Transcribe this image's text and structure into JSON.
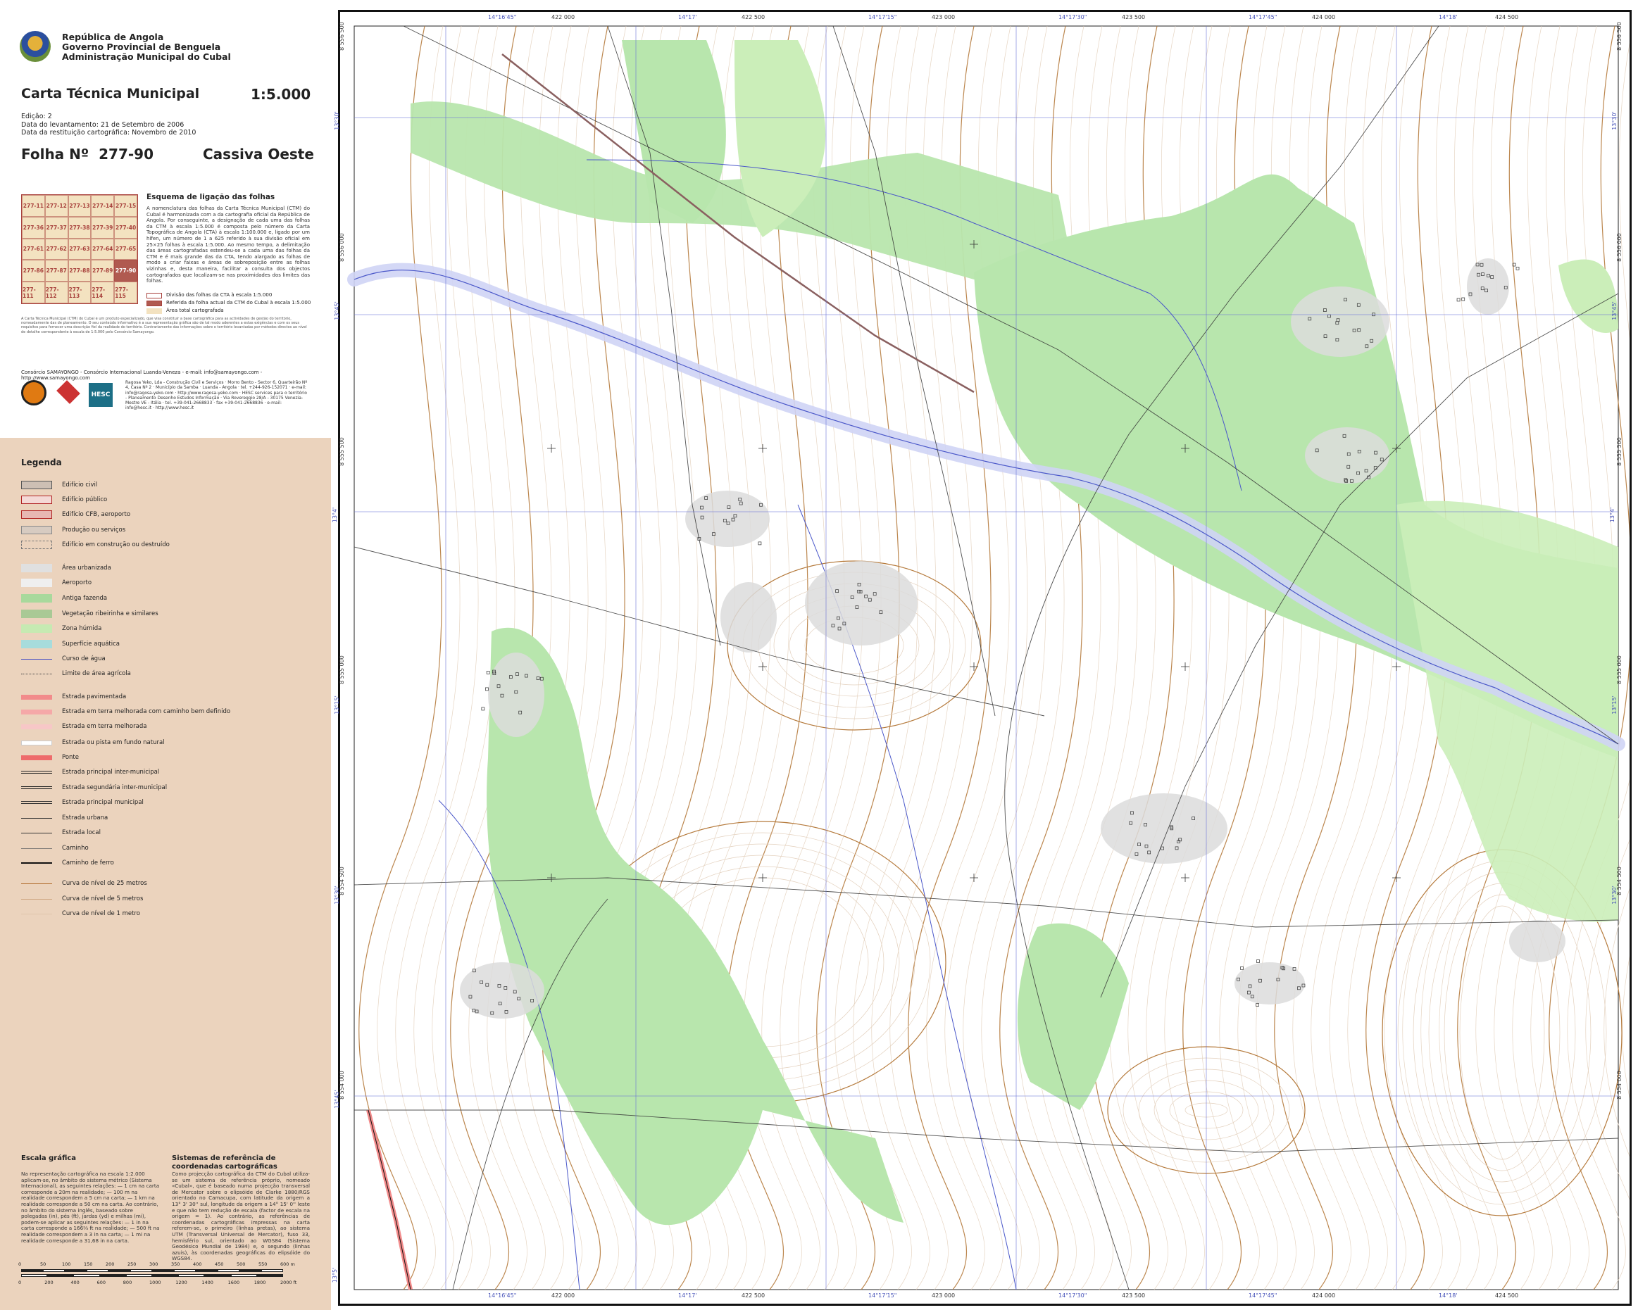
{
  "header": {
    "lines": [
      "República de Angola",
      "Governo Provincial de Benguela",
      "Administração Municipal do Cubal"
    ],
    "title": "Carta Técnica Municipal",
    "scale": "1:5.000",
    "edition": "Edição: 2",
    "survey_date": "Data do levantamento: 21 de Setembro de 2006",
    "restitution_date": "Data da restituição cartográfica: Novembro de 2010",
    "folha_label": "Folha Nº",
    "folha_number": "277-90",
    "folha_name": "Cassiva Oeste"
  },
  "index_map": {
    "title": "Esquema de ligação das folhas",
    "sheets": [
      "277-11",
      "277-12",
      "277-13",
      "277-14",
      "277-15",
      "277-36",
      "277-37",
      "277-38",
      "277-39",
      "277-40",
      "277-61",
      "277-62",
      "277-63",
      "277-64",
      "277-65",
      "277-86",
      "277-87",
      "277-88",
      "277-89",
      "277-90",
      "277-111",
      "277-112",
      "277-113",
      "277-114",
      "277-115"
    ],
    "current": "277-90",
    "text": "A nomenclatura das folhas da Carta Técnica Municipal (CTM) do Cubal é harmonizada com a da cartografia oficial da República de Angola. Por conseguinte, a designação de cada uma das folhas da CTM à escala 1:5.000 é composta pelo número da Carta Topográfica de Angola (CTA) à escala 1:100.000 e, ligado por um hífen, um número de 1 a 625 referido à sua divisão oficial em 25×25 folhas à escala 1:5.000. Ao mesmo tempo, a delimitação das áreas cartografadas estendeu-se a cada uma das folhas da CTM e é mais grande das da CTA, tendo alargado as folhas de modo a criar faixas e áreas de sobreposição entre as folhas vizinhas e, desta maneira, facilitar a consulta dos objectos cartografados que localizam-se nas proximidades dos limites das folhas.",
    "legend": [
      "Divisão das folhas da CTA à escala 1:5.000",
      "Referida da folha actual da CTM do Cubal à escala 1:5.000",
      "Área total cartografada"
    ]
  },
  "fine_print": "A Carta Técnica Municipal (CTM) do Cubal é um produto especializado, que visa constituir a base cartográfica para as actividades de gestão do território, nomeadamente das de planeamento. O seu conteúdo informativo é a sua representação gráfica são de tal modo aderentes a estas exigências e com os seus requisitos para fornecer uma descrição fiel da realidade do território. Contrariamente das informações sobre o território levantadas por métodos directos ao nível de detalhe correspondente à escala de 1:5.000 pelo Consórcio Samayongo.",
  "consortium": {
    "line": "Consórcio SAMAYONGO - Consórcio Internacional Luanda-Veneza - e-mail: info@samayongo.com - http://www.samayongo.com",
    "partners": "Ragosa Yeko, Lda - Construção Civil e Serviços · Morro Bento - Sector 6, Quarteirão Nº 4, Casa Nº 2 · Município da Samba · Luanda - Angola · tel. +244-926-152071 · e-mail: info@ragosa-yeko.com · http://www.ragosa-yeko.com · HESC services para o território - Planeamento Desenho Estudos Informação · Via Rovereggio 28/A - 30175 Venezia-Mestre VE - Itália · tel. +39-041-2668833 · fax +39-041-2668836 · e-mail: info@hesc.it · http://www.hesc.it",
    "logo3": "HESC"
  },
  "legend": {
    "title": "Legenda",
    "items": [
      {
        "label": "Edifício civil",
        "fill": "#cdbfb4",
        "stroke": "#555555",
        "kind": "box"
      },
      {
        "label": "Edifício público",
        "fill": "#f4d9d6",
        "stroke": "#b02020",
        "kind": "box"
      },
      {
        "label": "Edifício CFB, aeroporto",
        "fill": "#e7b7b3",
        "stroke": "#b02020",
        "kind": "box"
      },
      {
        "label": "Produção ou serviços",
        "fill": "#d7cbc1",
        "stroke": "#888888",
        "kind": "box"
      },
      {
        "label": "Edifício em construção ou destruído",
        "fill": "none",
        "stroke": "#777777",
        "kind": "dashbox"
      },
      {
        "label": "Área urbanizada",
        "fill": "#e0e0e0",
        "stroke": "none",
        "kind": "box"
      },
      {
        "label": "Aeroporto",
        "fill": "#efefef",
        "stroke": "none",
        "kind": "box"
      },
      {
        "label": "Antiga fazenda",
        "fill": "#a8d99c",
        "stroke": "none",
        "kind": "box"
      },
      {
        "label": "Vegetação ribeirinha e similares",
        "fill": "#a9c995",
        "stroke": "none",
        "kind": "box"
      },
      {
        "label": "Zona húmida",
        "fill": "#c6eab2",
        "stroke": "none",
        "kind": "box"
      },
      {
        "label": "Superfície aquática",
        "fill": "#a7dcdc",
        "stroke": "none",
        "kind": "box"
      },
      {
        "label": "Curso de água",
        "fill": "none",
        "stroke": "#3f49c4",
        "kind": "line"
      },
      {
        "label": "Limite de área agrícola",
        "fill": "none",
        "stroke": "#444444",
        "kind": "dotline"
      },
      {
        "label": "Estrada pavimentada",
        "fill": "#f28b8b",
        "stroke": "none",
        "kind": "band"
      },
      {
        "label": "Estrada em terra melhorada com caminho bem definido",
        "fill": "#f5a8a8",
        "stroke": "none",
        "kind": "band"
      },
      {
        "label": "Estrada em terra melhorada",
        "fill": "#f7c7c7",
        "stroke": "none",
        "kind": "band"
      },
      {
        "label": "Estrada ou pista em fundo natural",
        "fill": "#ffffff",
        "stroke": "none",
        "kind": "band"
      },
      {
        "label": "Ponte",
        "fill": "#ee6b6b",
        "stroke": "none",
        "kind": "band"
      },
      {
        "label": "Estrada principal inter-municipal",
        "fill": "none",
        "stroke": "#222222",
        "kind": "double"
      },
      {
        "label": "Estrada segundária inter-municipal",
        "fill": "none",
        "stroke": "#222222",
        "kind": "double"
      },
      {
        "label": "Estrada principal municipal",
        "fill": "none",
        "stroke": "#333333",
        "kind": "double"
      },
      {
        "label": "Estrada urbana",
        "fill": "none",
        "stroke": "#333333",
        "kind": "line"
      },
      {
        "label": "Estrada local",
        "fill": "none",
        "stroke": "#333333",
        "kind": "line"
      },
      {
        "label": "Caminho",
        "fill": "none",
        "stroke": "#666666",
        "kind": "thin"
      },
      {
        "label": "Caminho de ferro",
        "fill": "none",
        "stroke": "#111111",
        "kind": "rail"
      },
      {
        "label": "Curva de nível de 25 metros",
        "fill": "none",
        "stroke": "#b06a2a",
        "kind": "line"
      },
      {
        "label": "Curva de nível de 5 metros",
        "fill": "none",
        "stroke": "#c79a70",
        "kind": "thin"
      },
      {
        "label": "Curva de nível de 1 metro",
        "fill": "none",
        "stroke": "#ddc2a8",
        "kind": "thin"
      }
    ]
  },
  "scale_section": {
    "title": "Escala gráfica",
    "text": "Na representação cartográfica na escala 1:2.000 aplicam-se, no âmbito do sistema métrico (Sistema Internacional), as seguintes relações: — 1 cm na carta corresponde a 20m na realidade; — 100 m na realidade correspondem a 5 cm na carta; — 1 km na realidade corresponde a 50 cm na carta. Ao contrário, no âmbito do sistema inglês, baseado sobre polegadas (in), pés (ft), jardas (yd) e milhas (mi), podem-se aplicar as seguintes relações: — 1 in na carta corresponde a 166⅔ ft na realidade; — 500 ft na realidade correspondem a 3 in na carta; — 1 mi na realidade corresponde a 31,68 in na carta.",
    "meters_ticks": [
      "0",
      "50",
      "100",
      "150",
      "200",
      "250",
      "300",
      "350",
      "400",
      "450",
      "500",
      "550",
      "600 m"
    ],
    "feet_ticks": [
      "0",
      "200",
      "400",
      "600",
      "800",
      "1000",
      "1200",
      "1400",
      "1600",
      "1800",
      "2000 ft"
    ]
  },
  "crs_section": {
    "title": "Sistemas de referência de coordenadas cartográficas",
    "text": "Como projecção cartográfica da CTM do Cubal utiliza-se um sistema de referência próprio, nomeado «Cubal», que é baseado numa projecção transversal de Mercator sobre o elipsóide de Clarke 1880/RGS orientado no Camacupa, com latitude da origem a 13° 3' 30'' sul, longitude da origem a 14° 15' 0'' leste e que não tem redução de escala (factor de escala na origem = 1). Ao contrário, as referências de coordenadas cartográficas impressas na carta referem-se, o primeiro (linhas pretas), ao sistema UTM (Transversal Universal de Mercator), fuso 33, hemisfério sul, orientado ao WGS84 (Sistema Geodésico Mundial de 1984) e, o segundo (linhas azuis), às coordenadas geográficas do elipsóide do WGS84."
  },
  "map": {
    "top_labels": [
      {
        "text": "14°16'45\"",
        "color": "blue"
      },
      {
        "text": "422 000",
        "color": "black"
      },
      {
        "text": "14°17'",
        "color": "blue"
      },
      {
        "text": "422 500",
        "color": "black"
      },
      {
        "text": "14°17'15\"",
        "color": "blue"
      },
      {
        "text": "423 000",
        "color": "black"
      },
      {
        "text": "14°17'30\"",
        "color": "blue"
      },
      {
        "text": "423 500",
        "color": "black"
      },
      {
        "text": "14°17'45\"",
        "color": "blue"
      },
      {
        "text": "424 000",
        "color": "black"
      },
      {
        "text": "14°18'",
        "color": "blue"
      },
      {
        "text": "424 500",
        "color": "black"
      }
    ],
    "bottom_labels": [
      {
        "text": "14°16'45\"",
        "color": "blue"
      },
      {
        "text": "422 000",
        "color": "black"
      },
      {
        "text": "14°17'",
        "color": "blue"
      },
      {
        "text": "422 500",
        "color": "black"
      },
      {
        "text": "14°17'15\"",
        "color": "blue"
      },
      {
        "text": "423 000",
        "color": "black"
      },
      {
        "text": "14°17'30\"",
        "color": "blue"
      },
      {
        "text": "423 500",
        "color": "black"
      },
      {
        "text": "14°17'45\"",
        "color": "blue"
      },
      {
        "text": "424 000",
        "color": "black"
      },
      {
        "text": "14°18'",
        "color": "blue"
      },
      {
        "text": "424 500",
        "color": "black"
      }
    ],
    "left_labels": [
      {
        "text": "8 556 500",
        "color": "black"
      },
      {
        "text": "13°30'",
        "color": "blue"
      },
      {
        "text": "13°45'",
        "color": "blue"
      },
      {
        "text": "8 556 000",
        "color": "black"
      },
      {
        "text": "8 555 500",
        "color": "black"
      },
      {
        "text": "13°4'",
        "color": "blue"
      },
      {
        "text": "8 555 000",
        "color": "black"
      },
      {
        "text": "13°15'",
        "color": "blue"
      },
      {
        "text": "8 554 500",
        "color": "black"
      },
      {
        "text": "13°30'",
        "color": "blue"
      },
      {
        "text": "8 554 000",
        "color": "black"
      },
      {
        "text": "13°45'",
        "color": "blue"
      },
      {
        "text": "13°5'",
        "color": "blue"
      }
    ],
    "right_labels": [
      {
        "text": "8 556 500",
        "color": "black"
      },
      {
        "text": "13°30'",
        "color": "blue"
      },
      {
        "text": "8 556 000",
        "color": "black"
      },
      {
        "text": "13°45'",
        "color": "blue"
      },
      {
        "text": "8 555 500",
        "color": "black"
      },
      {
        "text": "13°4'",
        "color": "blue"
      },
      {
        "text": "8 555 000",
        "color": "black"
      },
      {
        "text": "13°15'",
        "color": "blue"
      },
      {
        "text": "8 554 500",
        "color": "black"
      },
      {
        "text": "13°30'",
        "color": "blue"
      },
      {
        "text": "8 554 000",
        "color": "black"
      }
    ],
    "colors": {
      "farm": "#b8e6ad",
      "wetland": "#cbeeb9",
      "water": "#cfd4f5",
      "river": "#4a57c9",
      "contour_major": "#b57a3c",
      "contour_minor": "#e3d0bd",
      "road": "#333333",
      "urban": "#dcdcdc",
      "grid": "#6a72d6"
    }
  }
}
